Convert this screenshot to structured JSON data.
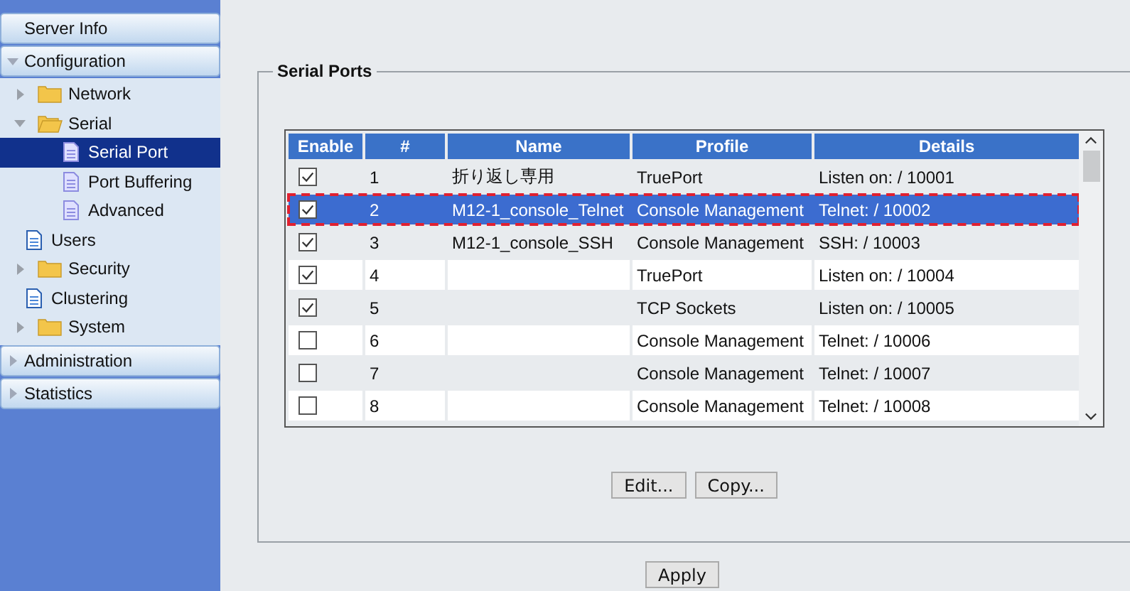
{
  "sidebar": {
    "sections": [
      {
        "label": "Server Info"
      },
      {
        "label": "Configuration",
        "expanded": true,
        "children": [
          {
            "label": "Network",
            "kind": "folder",
            "expanded": false,
            "selected": false
          },
          {
            "label": "Serial",
            "kind": "folder",
            "expanded": true,
            "selected": false,
            "children": [
              {
                "label": "Serial Port",
                "kind": "subpage",
                "selected": true
              },
              {
                "label": "Port Buffering",
                "kind": "subpage",
                "selected": false
              },
              {
                "label": "Advanced",
                "kind": "subpage",
                "selected": false
              }
            ]
          },
          {
            "label": "Users",
            "kind": "page",
            "selected": false
          },
          {
            "label": "Security",
            "kind": "folder",
            "expanded": false,
            "selected": false
          },
          {
            "label": "Clustering",
            "kind": "page",
            "selected": false
          },
          {
            "label": "System",
            "kind": "folder",
            "expanded": false,
            "selected": false
          }
        ]
      },
      {
        "label": "Administration",
        "expanded": false
      },
      {
        "label": "Statistics",
        "expanded": false
      }
    ]
  },
  "panel": {
    "title": "Serial Ports",
    "table": {
      "columns": [
        "Enable",
        "#",
        "Name",
        "Profile",
        "Details"
      ],
      "rows": [
        {
          "enabled": true,
          "selected": false,
          "number": "1",
          "name": "折り返し専用",
          "profile": "TruePort",
          "details": "Listen on: / 10001"
        },
        {
          "enabled": true,
          "selected": true,
          "number": "2",
          "name": "M12-1_console_Telnet",
          "profile": "Console Management",
          "details": "Telnet: / 10002"
        },
        {
          "enabled": true,
          "selected": false,
          "number": "3",
          "name": "M12-1_console_SSH",
          "profile": "Console Management",
          "details": "SSH: / 10003"
        },
        {
          "enabled": true,
          "selected": false,
          "number": "4",
          "profile": "TruePort",
          "details": "Listen on: / 10004"
        },
        {
          "enabled": true,
          "selected": false,
          "number": "5",
          "profile": "TCP Sockets",
          "details": "Listen on: / 10005"
        },
        {
          "enabled": false,
          "selected": false,
          "number": "6",
          "profile": "Console Management",
          "details": "Telnet: / 10006"
        },
        {
          "enabled": false,
          "selected": false,
          "number": "7",
          "profile": "Console Management",
          "details": "Telnet: / 10007"
        },
        {
          "enabled": false,
          "selected": false,
          "number": "8",
          "profile": "Console Management",
          "details": "Telnet: / 10008"
        }
      ]
    },
    "buttons": [
      "Edit...",
      "Copy..."
    ]
  },
  "apply_button": "Apply"
}
